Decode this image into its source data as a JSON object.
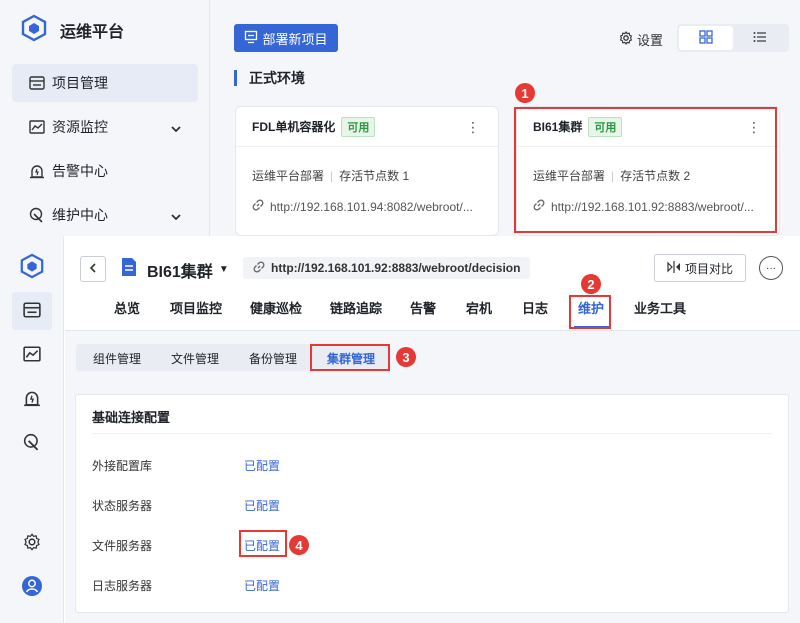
{
  "top": {
    "brand": "运维平台",
    "sidebar": [
      {
        "label": "项目管理",
        "icon": "project-icon",
        "active": true
      },
      {
        "label": "资源监控",
        "icon": "monitor-icon",
        "expandable": true
      },
      {
        "label": "告警中心",
        "icon": "alarm-icon"
      },
      {
        "label": "维护中心",
        "icon": "maintain-icon",
        "expandable": true
      }
    ],
    "deploy_button": "部署新项目",
    "settings_label": "设置",
    "env_title": "正式环境",
    "cards": [
      {
        "name": "FDL单机容器化",
        "status": "可用",
        "deploy_type": "运维平台部署",
        "nodes": "存活节点数 1",
        "url": "http://192.168.101.94:8082/webroot/..."
      },
      {
        "name": "BI61集群",
        "status": "可用",
        "deploy_type": "运维平台部署",
        "nodes": "存活节点数 2",
        "url": "http://192.168.101.92:8883/webroot/..."
      }
    ],
    "more_glyph": "⋮"
  },
  "bottom": {
    "project_name": "BI61集群",
    "url": "http://192.168.101.92:8883/webroot/decision",
    "compare_button": "项目对比",
    "more_glyph": "···",
    "tabs": [
      "总览",
      "项目监控",
      "健康巡检",
      "链路追踪",
      "告警",
      "宕机",
      "日志",
      "维护",
      "业务工具"
    ],
    "active_tab": "维护",
    "subtabs": [
      "组件管理",
      "文件管理",
      "备份管理",
      "集群管理"
    ],
    "active_subtab": "集群管理",
    "panel": {
      "title": "基础连接配置",
      "rows": [
        {
          "label": "外接配置库",
          "value": "已配置"
        },
        {
          "label": "状态服务器",
          "value": "已配置"
        },
        {
          "label": "文件服务器",
          "value": "已配置"
        },
        {
          "label": "日志服务器",
          "value": "已配置"
        }
      ]
    }
  },
  "annotations": [
    "1",
    "2",
    "3",
    "4"
  ],
  "colors": {
    "accent": "#3566d6",
    "highlight": "#e53935",
    "ok": "#2a9a3e"
  }
}
